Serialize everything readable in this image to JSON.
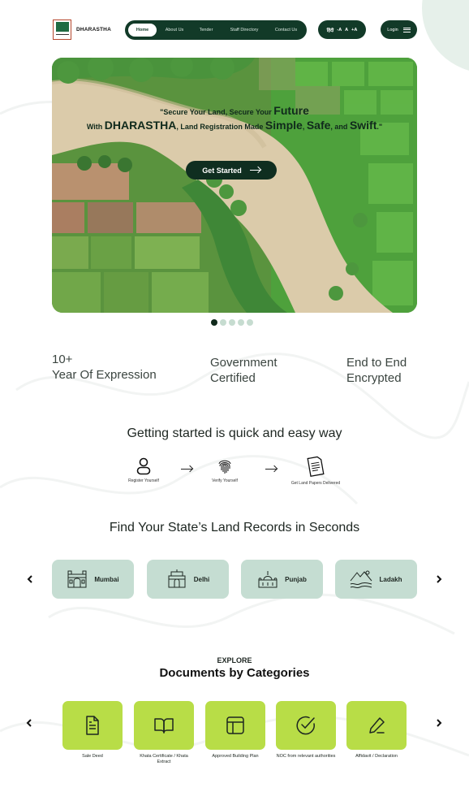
{
  "header": {
    "brand": "DHARASTHA",
    "nav": [
      "Home",
      "About Us",
      "Tender",
      "Staff Directory",
      "Contact Us"
    ],
    "language": "हिंदी",
    "font_sizes": [
      "-A",
      "A",
      "+A"
    ],
    "login": "Login"
  },
  "hero": {
    "line1_prefix": "\"Secure Your Land, Secure Your ",
    "line1_big": "Future",
    "line2_with": "With ",
    "line2_brand": "DHARASTHA",
    "line2_mid": ", Land Registration Made ",
    "line2_simple": "Simple",
    "line2_comma": ", ",
    "line2_safe": "Safe",
    "line2_and": ", and ",
    "line2_swift": "Swift",
    "line2_end": ".\"",
    "cta": "Get Started",
    "slides": 5,
    "active_slide": 1
  },
  "stats": [
    {
      "line1": "10+",
      "line2": "Year Of Expression"
    },
    {
      "line1": "Government",
      "line2": "Certified"
    },
    {
      "line1": "End to End",
      "line2": "Encrypted"
    }
  ],
  "steps": {
    "title": "Getting started is quick and easy way",
    "items": [
      {
        "label": "Register Yourself",
        "icon": "person-icon"
      },
      {
        "label": "Verify Yourself",
        "icon": "fingerprint-icon"
      },
      {
        "label": "Get Land Papers Delivered",
        "icon": "document-icon"
      }
    ]
  },
  "states": {
    "title": "Find Your State’s Land Records in Seconds",
    "items": [
      {
        "name": "Mumbai",
        "icon": "gateway-icon"
      },
      {
        "name": "Delhi",
        "icon": "india-gate-icon"
      },
      {
        "name": "Punjab",
        "icon": "golden-temple-icon"
      },
      {
        "name": "Ladakh",
        "icon": "mountain-lake-icon"
      }
    ]
  },
  "categories": {
    "eyebrow": "EXPLORE",
    "title": "Documents by Categories",
    "items": [
      {
        "label": "Sale Deed",
        "icon": "file-text-icon"
      },
      {
        "label": "Khata Certificate / Khata Extract",
        "icon": "book-open-icon"
      },
      {
        "label": "Approved Building Plan",
        "icon": "layout-icon"
      },
      {
        "label": "NOC from relevant authorities",
        "icon": "check-circle-icon"
      },
      {
        "label": "Affidavit / Declaration",
        "icon": "pen-icon"
      }
    ]
  },
  "colors": {
    "dark_green": "#123a28",
    "mint": "#c5ddd2",
    "lime": "#b8dd47"
  }
}
